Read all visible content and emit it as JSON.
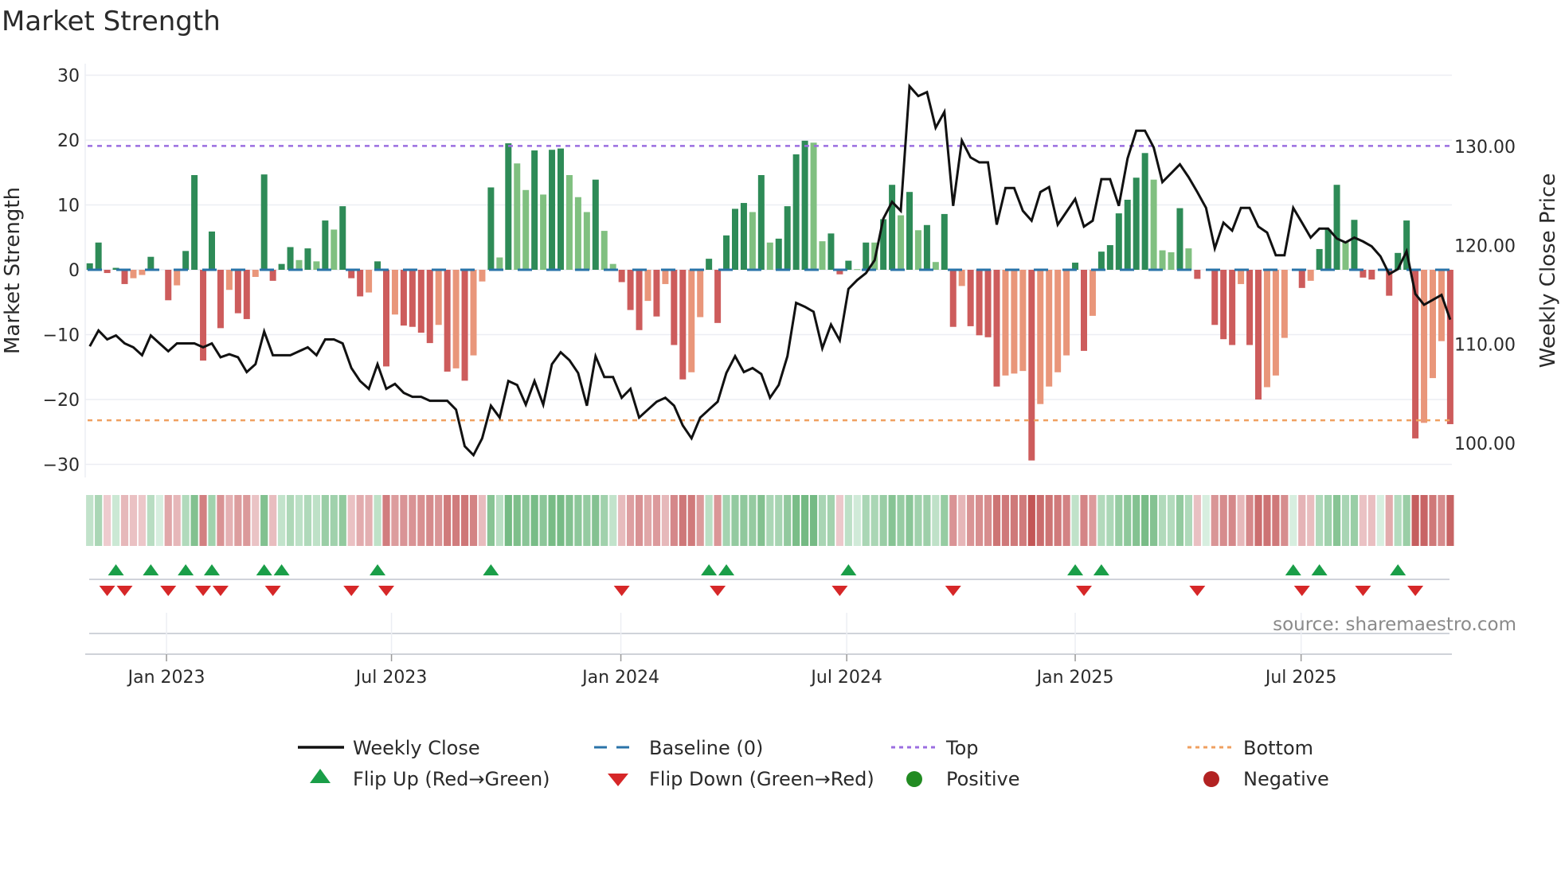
{
  "title": "Market Strength",
  "source": "source: sharemaestro.com",
  "chart_data": {
    "type": "bar",
    "title": "Market Strength",
    "ylabel": "Market Strength",
    "y2label": "Weekly Close Price",
    "ylim": [
      -31.5,
      32
    ],
    "y2lim": [
      96,
      138
    ],
    "yticks": [
      30,
      20,
      10,
      0,
      -10,
      -20,
      -30
    ],
    "yticklabels": [
      "30",
      "20",
      "10",
      "0",
      "−10",
      "−20",
      "−30"
    ],
    "y2ticks": [
      130,
      120,
      110,
      100
    ],
    "y2ticklabels": [
      "130.00",
      "120.00",
      "110.00",
      "100.00"
    ],
    "x_unit": "week index (weekly bars, Nov 2022 – Oct 2025)",
    "xticks": [
      {
        "label": "Jan 2023",
        "week": 8.8
      },
      {
        "label": "Jul 2023",
        "week": 34.6
      },
      {
        "label": "Jan 2024",
        "week": 60.9
      },
      {
        "label": "Jul 2024",
        "week": 86.8
      },
      {
        "label": "Jan 2025",
        "week": 113.0
      },
      {
        "label": "Jul 2025",
        "week": 138.9
      }
    ],
    "top_level": 19.1,
    "bottom_level": -23.2,
    "baseline": 0,
    "strength": [
      1,
      4.2,
      -0.5,
      0.3,
      -2.2,
      -1.3,
      -0.8,
      2,
      0,
      -4.7,
      -2.4,
      2.9,
      14.6,
      -14,
      5.9,
      -9,
      -3.1,
      -6.7,
      -7.6,
      -1.1,
      14.7,
      -1.7,
      0.9,
      3.5,
      1.5,
      3.3,
      1.3,
      7.6,
      6.2,
      9.8,
      -1.3,
      -4.1,
      -3.5,
      1.3,
      -14.9,
      -6.9,
      -8.6,
      -8.8,
      -9.7,
      -11.3,
      -8.5,
      -15.7,
      -15.2,
      -17.1,
      -13.2,
      -1.8,
      12.7,
      1.9,
      19.5,
      16.4,
      12.3,
      18.4,
      11.6,
      18.5,
      18.7,
      14.6,
      11.2,
      8.9,
      13.9,
      6,
      0.9,
      -1.9,
      -6.2,
      -9.3,
      -4.8,
      -7.2,
      -2.2,
      -11.6,
      -16.9,
      -15.8,
      -7.3,
      1.7,
      -8.2,
      5.3,
      9.4,
      10.3,
      8.9,
      14.6,
      4.2,
      4.8,
      9.8,
      17.8,
      19.9,
      19.6,
      4.4,
      5.6,
      -0.7,
      1.4,
      0.1,
      4.2,
      4.2,
      7.8,
      13.1,
      8.4,
      12,
      6.1,
      6.9,
      1.2,
      8.6,
      -8.8,
      -2.5,
      -8.7,
      -10.1,
      -10.4,
      -18,
      -16.3,
      -16,
      -15.6,
      -29.4,
      -20.7,
      -18,
      -15.8,
      -13.2,
      1.1,
      -12.5,
      -7.1,
      2.8,
      3.8,
      8.7,
      10.8,
      14.2,
      18,
      13.9,
      3,
      2.7,
      9.5,
      3.3,
      -1.4,
      0,
      -8.5,
      -10.7,
      -11.6,
      -2.2,
      -11.6,
      -20,
      -18.1,
      -16.3,
      -10.5,
      0,
      -2.8,
      -1.7,
      3.2,
      6.2,
      13.1,
      4.4,
      7.7,
      -1.2,
      -1.5,
      0,
      -4,
      2.6,
      7.6,
      -26,
      -23.6,
      -16.7,
      -11,
      -23.8
    ],
    "shade": [
      "d",
      "d",
      "d",
      "d",
      "d",
      "l",
      "l",
      "d",
      "d",
      "d",
      "l",
      "d",
      "d",
      "d",
      "d",
      "d",
      "l",
      "d",
      "d",
      "l",
      "d",
      "d",
      "d",
      "d",
      "l",
      "d",
      "l",
      "d",
      "l",
      "d",
      "d",
      "d",
      "l",
      "d",
      "d",
      "l",
      "d",
      "d",
      "d",
      "d",
      "l",
      "d",
      "l",
      "d",
      "l",
      "l",
      "d",
      "l",
      "d",
      "l",
      "l",
      "d",
      "l",
      "d",
      "d",
      "l",
      "l",
      "l",
      "d",
      "l",
      "l",
      "d",
      "d",
      "d",
      "l",
      "d",
      "l",
      "d",
      "d",
      "l",
      "l",
      "d",
      "d",
      "d",
      "d",
      "d",
      "l",
      "d",
      "l",
      "d",
      "d",
      "d",
      "d",
      "l",
      "l",
      "d",
      "d",
      "d",
      "l",
      "d",
      "l",
      "d",
      "d",
      "l",
      "d",
      "l",
      "d",
      "l",
      "d",
      "d",
      "l",
      "d",
      "d",
      "d",
      "d",
      "l",
      "l",
      "l",
      "d",
      "l",
      "l",
      "l",
      "l",
      "d",
      "d",
      "l",
      "d",
      "d",
      "d",
      "d",
      "d",
      "d",
      "l",
      "l",
      "l",
      "d",
      "l",
      "d",
      "d",
      "d",
      "d",
      "d",
      "l",
      "d",
      "d",
      "l",
      "l",
      "l",
      "d",
      "d",
      "l",
      "d",
      "d",
      "d",
      "l",
      "d",
      "d",
      "d",
      "d",
      "d",
      "d",
      "d",
      "d",
      "l",
      "l",
      "l",
      "d"
    ],
    "price": [
      109.8,
      111.4,
      110.5,
      110.9,
      110.1,
      109.7,
      108.9,
      110.9,
      110.1,
      109.3,
      110.1,
      110.1,
      110.1,
      109.7,
      110.1,
      108.7,
      109,
      108.7,
      107.2,
      108,
      111.3,
      108.9,
      108.9,
      108.9,
      109.3,
      109.7,
      108.9,
      110.5,
      110.5,
      110.1,
      107.6,
      106.3,
      105.5,
      108,
      105.5,
      106,
      105.1,
      104.7,
      104.7,
      104.3,
      104.3,
      104.3,
      103.4,
      99.7,
      98.8,
      100.5,
      103.8,
      102.6,
      106.3,
      105.9,
      103.9,
      106.3,
      103.9,
      108,
      109.2,
      108.4,
      107.1,
      103.8,
      108.8,
      106.7,
      106.7,
      104.6,
      105.5,
      102.6,
      103.4,
      104.2,
      104.6,
      103.8,
      101.8,
      100.5,
      102.6,
      103.4,
      104.2,
      107.1,
      108.8,
      107.2,
      107.6,
      107,
      104.6,
      105.9,
      108.8,
      114.2,
      113.8,
      113.3,
      109.6,
      112,
      110.4,
      115.6,
      116.5,
      117.2,
      118.5,
      122.7,
      124.4,
      123.5,
      136.1,
      135.1,
      135.5,
      131.9,
      133.5,
      124,
      130.6,
      128.9,
      128.4,
      128.4,
      122.1,
      125.8,
      125.8,
      123.5,
      122.5,
      125.4,
      125.9,
      122.1,
      123.4,
      124.7,
      121.9,
      122.5,
      126.7,
      126.7,
      124,
      128.8,
      131.6,
      131.6,
      129.9,
      126.4,
      127.3,
      128.2,
      126.9,
      125.4,
      123.8,
      119.7,
      122.3,
      121.5,
      123.8,
      123.8,
      121.9,
      121.3,
      119,
      119,
      123.8,
      122.3,
      120.8,
      121.7,
      121.7,
      120.7,
      120.3,
      120.8,
      120.4,
      119.9,
      118.9,
      117.1,
      117.6,
      119.4,
      115.1,
      114,
      114.5,
      115,
      112.5
    ],
    "flip_up_weeks": [
      3,
      7,
      11,
      14,
      20,
      22,
      33,
      46,
      71,
      73,
      87,
      113,
      116,
      138,
      141,
      150
    ],
    "flip_down_weeks": [
      2,
      4,
      9,
      13,
      15,
      21,
      30,
      34,
      61,
      72,
      86,
      99,
      114,
      127,
      139,
      146,
      152
    ],
    "colors": {
      "positive_strong": "#2e8b57",
      "positive_weak": "#80c080",
      "negative_strong": "#cd5c5c",
      "negative_weak": "#e9967a",
      "baseline": "#2a73a8",
      "top": "#9b6ee0",
      "bottom": "#f0a060",
      "close": "#111111",
      "flip_up": "#1a9e48",
      "flip_down": "#d62728",
      "positive_dot": "#228b22",
      "negative_dot": "#b22222"
    },
    "legend": {
      "placement": "bottom",
      "weekly_close": "Weekly Close",
      "baseline": "Baseline (0)",
      "top": "Top",
      "bottom": "Bottom",
      "flip_up": "Flip Up (Red→Green)",
      "flip_down": "Flip Down (Green→Red)",
      "positive": "Positive",
      "negative": "Negative"
    }
  }
}
